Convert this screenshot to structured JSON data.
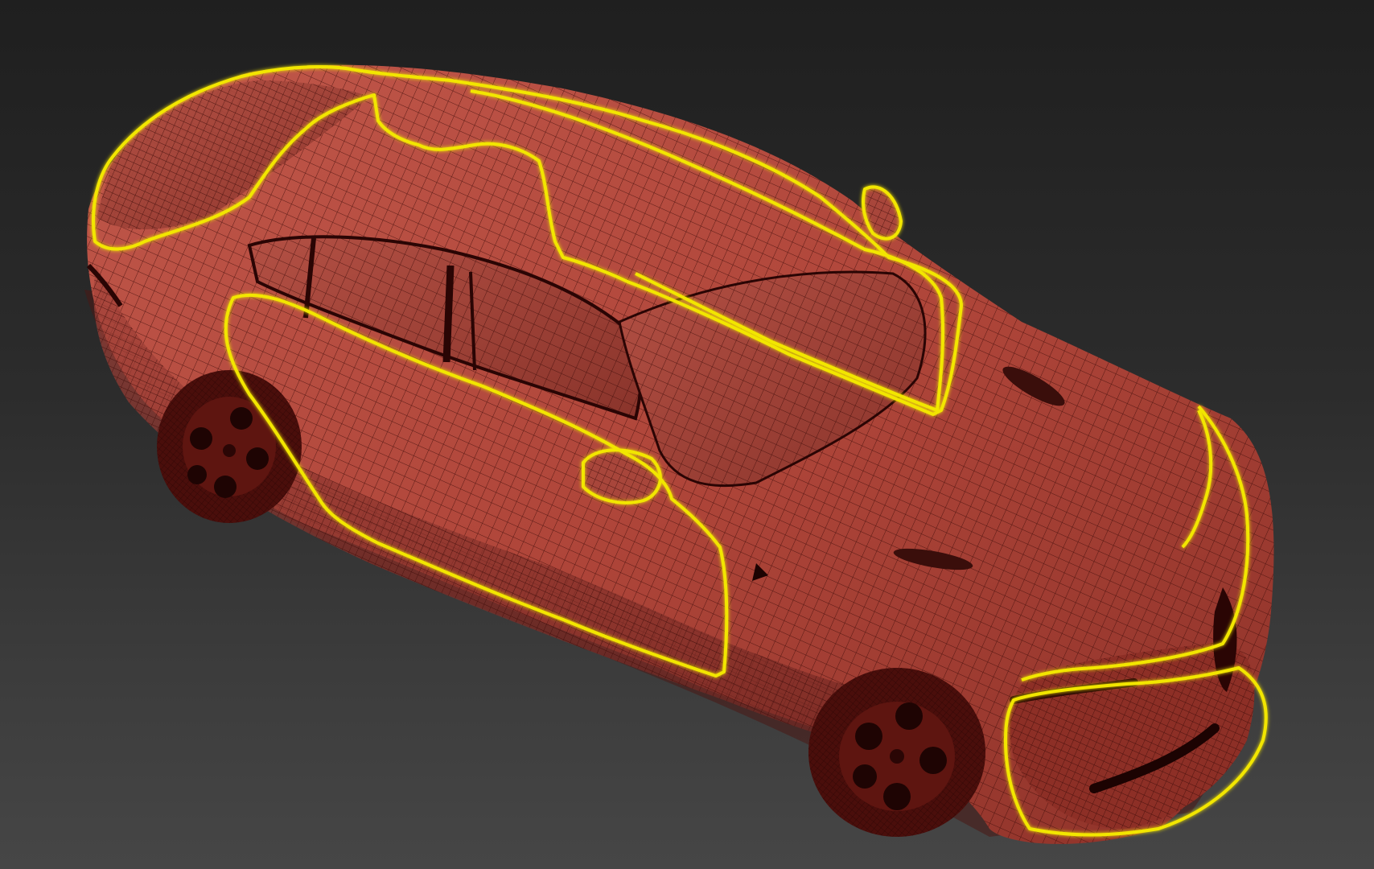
{
  "viewport": {
    "background_top": "#1f1f1f",
    "background_bottom": "#464646"
  },
  "model": {
    "object": "car-wireframe-mesh",
    "view": "perspective-top-three-quarter",
    "shading": "wireframe-on-shaded",
    "body_color": "#b5483c",
    "wire_color": "#3a0a08",
    "selection_color": "#f2e600",
    "selected_panels": [
      "roof",
      "windshield-area",
      "trunk-lid",
      "rear-door",
      "front-door",
      "hood-edge",
      "front-bumper"
    ]
  }
}
